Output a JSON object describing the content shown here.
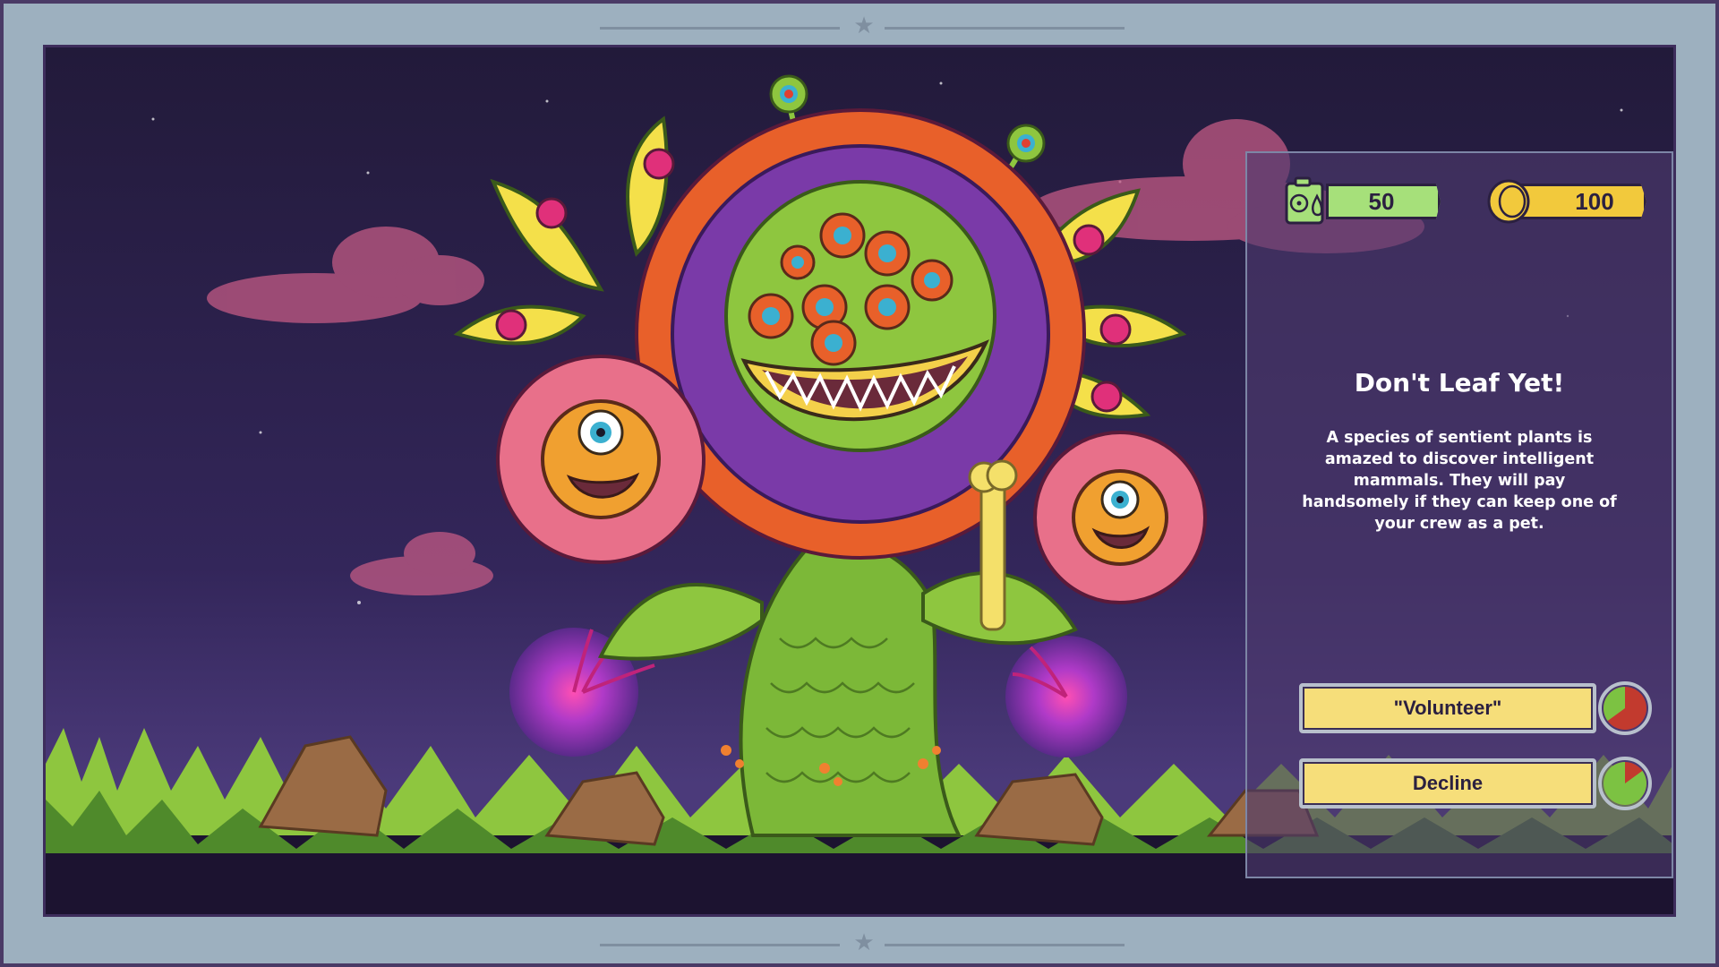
{
  "resources": {
    "fuel": {
      "icon": "fuel-canister-icon",
      "value": "50",
      "color": "#a6e07a"
    },
    "credits": {
      "icon": "coin-icon",
      "value": "100",
      "color": "#f2c93c"
    }
  },
  "event": {
    "title": "Don't Leaf Yet!",
    "description": "A species of sentient plants is amazed to discover intelligent mammals. They will pay handsomely if they can keep one of your crew as a pet."
  },
  "choices": [
    {
      "label": "\"Volunteer\"",
      "success_fraction": 0.35
    },
    {
      "label": "Decline",
      "success_fraction": 0.85
    }
  ],
  "colors": {
    "panel_bg": "#4e3a6e",
    "button_fill": "#f6de7a",
    "odds_good": "#7cc242",
    "odds_bad": "#c23a2e",
    "frame": "#9db0bf"
  }
}
